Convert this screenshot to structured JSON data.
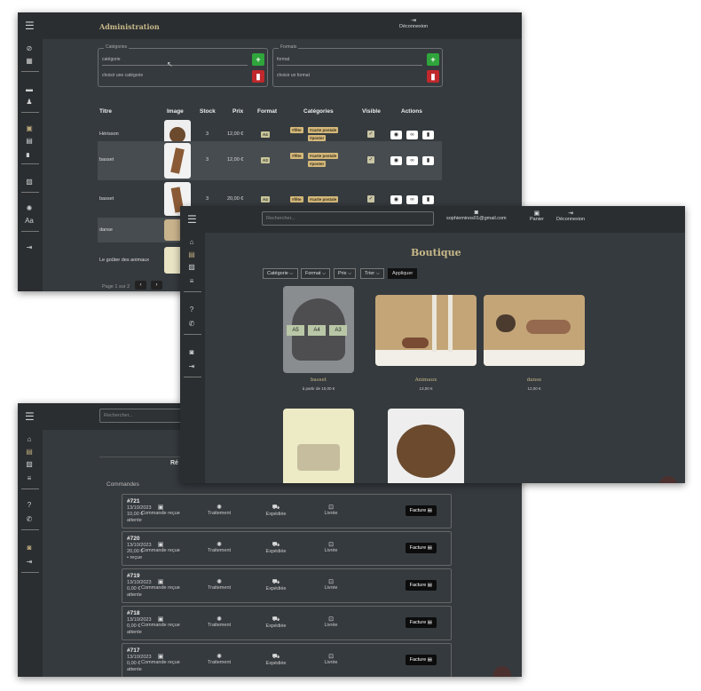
{
  "admin": {
    "title": "Administration",
    "logout_label": "Déconnexion",
    "categories": {
      "legend": "Catégories",
      "input_placeholder": "catégorie",
      "select_label": "choisir une catégorie"
    },
    "formats": {
      "legend": "Formats",
      "input_placeholder": "format",
      "select_label": "choisir un format"
    },
    "table": {
      "headers": [
        "Titre",
        "Image",
        "Stock",
        "Prix",
        "Format",
        "Catégories",
        "Visible",
        "Actions"
      ],
      "rows": [
        {
          "title": "Hérisson",
          "stock": "3",
          "price": "12,00 €",
          "format": "A4",
          "categories": [
            "#fête",
            "#carte postale",
            "#poster"
          ]
        },
        {
          "title": "basset",
          "stock": "3",
          "price": "12,00 €",
          "format": "A3",
          "categories": [
            "#fête",
            "#carte postale",
            "#poster"
          ]
        },
        {
          "title": "basset",
          "stock": "3",
          "price": "20,00 €",
          "format": "A4",
          "categories": [
            "#fête",
            "#carte postale"
          ]
        },
        {
          "title": "danse"
        },
        {
          "title": "Le goûter des animaux"
        }
      ]
    },
    "pagination_label": "Page 1 sur 2"
  },
  "shop": {
    "search_placeholder": "Rechercher...",
    "user_email": "sophieminos01@gmail.com",
    "cart_label": "Panier",
    "logout_label": "Déconnexion",
    "title": "Boutique",
    "filters": [
      "Catégorie",
      "Format",
      "Prix",
      "Trier"
    ],
    "apply_label": "Appliquer",
    "products": [
      {
        "title": "basset",
        "price": "à partir de 10,00 €",
        "formats": [
          "A5",
          "A4",
          "A3"
        ]
      },
      {
        "title": "Animaux",
        "price": "13,00 €"
      },
      {
        "title": "danse",
        "price": "12,00 €"
      }
    ]
  },
  "orders": {
    "search_placeholder": "Rechercher...",
    "section_title_partial": "Ré",
    "section_label": "Commandes",
    "steps": [
      "Commande reçue",
      "Traitement",
      "Expédiée",
      "Livrée"
    ],
    "invoice_label": "Facture",
    "items": [
      {
        "id": "#721",
        "date": "13/10/2023",
        "amount": "10,00 €",
        "status": "attente"
      },
      {
        "id": "#720",
        "date": "13/10/2023",
        "amount": "20,00 €",
        "status": "• reçue"
      },
      {
        "id": "#719",
        "date": "13/10/2023",
        "amount": "0,00 €",
        "status": "attente"
      },
      {
        "id": "#718",
        "date": "13/10/2023",
        "amount": "0,00 €",
        "status": "attente"
      },
      {
        "id": "#717",
        "date": "13/10/2023",
        "amount": "0,00 €",
        "status": "attente"
      }
    ]
  },
  "colors": {
    "bg": "#353a3e",
    "bar": "#2a2e31",
    "accent_gold": "#c8b98a",
    "add_green": "#2fa53b",
    "delete_red": "#c0282c"
  },
  "icons": [
    "menu-icon",
    "dashboard-icon",
    "users-icon",
    "cart-icon",
    "box-icon",
    "chart-icon",
    "settings-icon",
    "font-icon",
    "logout-icon",
    "home-icon",
    "image-icon",
    "list-icon",
    "help-icon",
    "phone-icon",
    "user-icon",
    "eye-icon",
    "link-icon",
    "trash-icon",
    "truck-icon",
    "check-icon",
    "file-icon"
  ]
}
